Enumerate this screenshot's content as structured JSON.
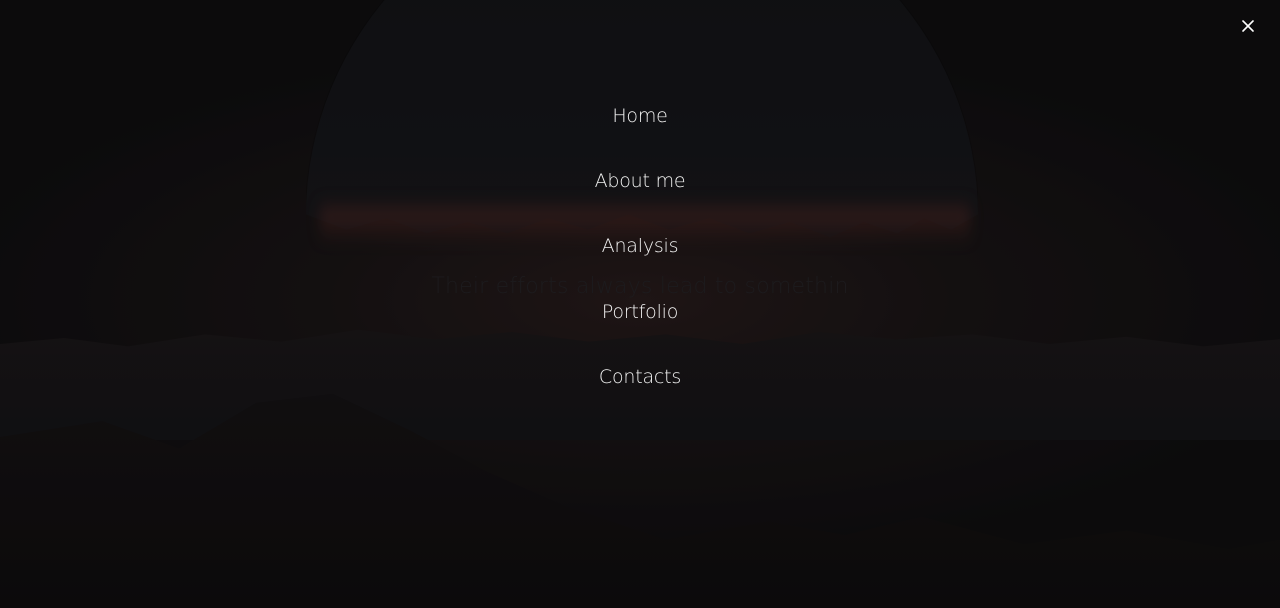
{
  "background": {
    "tagline": "Their efforts always lead to somethin"
  },
  "menu": {
    "items": [
      {
        "label": "Home"
      },
      {
        "label": "About me"
      },
      {
        "label": "Analysis"
      },
      {
        "label": "Portfolio"
      },
      {
        "label": "Contacts"
      }
    ]
  },
  "close_button": {
    "icon": "close-icon"
  },
  "colors": {
    "menu_text": "#f2f2f2",
    "overlay": "#0c0c0d"
  }
}
